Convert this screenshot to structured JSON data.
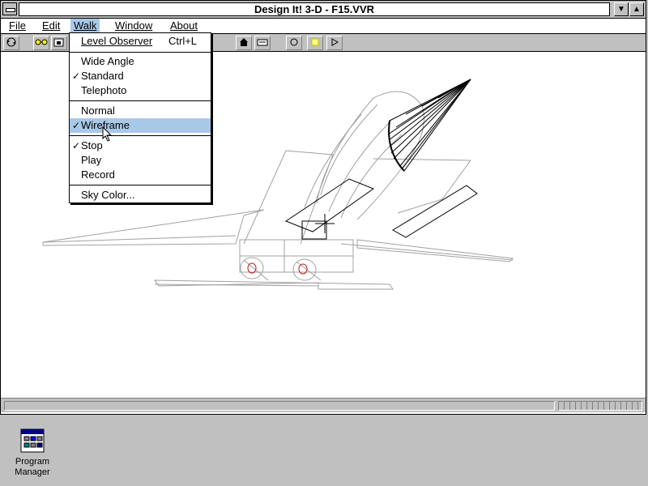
{
  "window": {
    "title": "Design It! 3-D - F15.VVR"
  },
  "menu": {
    "items": [
      {
        "label": "File",
        "name": "menu-file"
      },
      {
        "label": "Edit",
        "name": "menu-edit"
      },
      {
        "label": "Walk",
        "name": "menu-walk"
      },
      {
        "label": "Window",
        "name": "menu-window"
      },
      {
        "label": "About",
        "name": "menu-about"
      }
    ]
  },
  "walk_menu": {
    "level_observer": "Level Observer",
    "level_observer_shortcut": "Ctrl+L",
    "wide_angle": "Wide Angle",
    "standard": "Standard",
    "telephoto": "Telephoto",
    "normal": "Normal",
    "wireframe": "Wireframe",
    "stop": "Stop",
    "play": "Play",
    "record": "Record",
    "sky_color": "Sky Color...",
    "checkmark": "✓"
  },
  "toolbar": {
    "icons": [
      "rotate-icon",
      "glasses-icon",
      "camera-icon",
      "home-icon",
      "keyboard-icon",
      "record-circle-icon",
      "stop-square-icon",
      "play-triangle-icon"
    ]
  },
  "desktop": {
    "program_manager_label": "Program Manager"
  },
  "colors": {
    "highlight": "#a8c8e8",
    "desktop": "#c0c0c0"
  }
}
